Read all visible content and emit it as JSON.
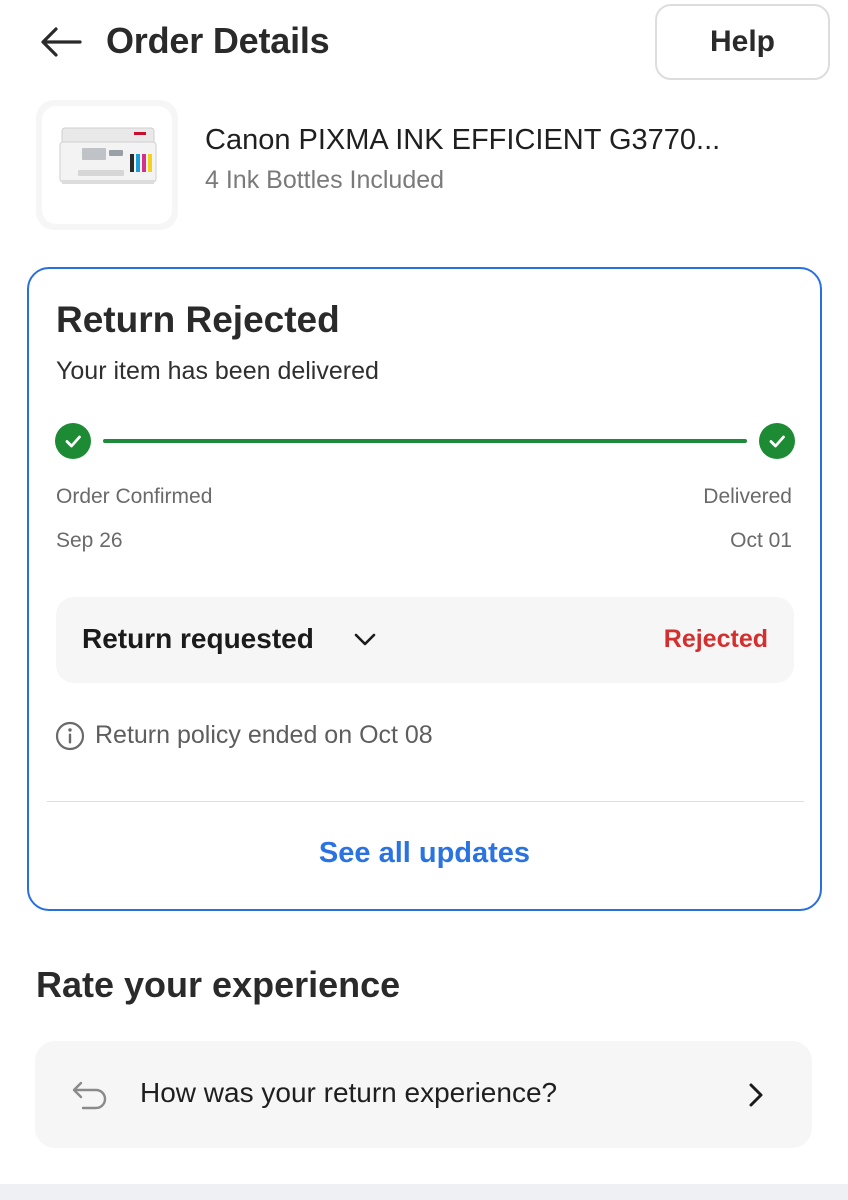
{
  "header": {
    "title": "Order Details",
    "help_label": "Help",
    "back_icon": "arrow-left-icon"
  },
  "product": {
    "name": "Canon PIXMA INK EFFICIENT G3770...",
    "variant": "4 Ink Bottles Included",
    "image": "printer-image"
  },
  "status_card": {
    "title": "Return Rejected",
    "subtitle": "Your item has been delivered",
    "tracker": {
      "progress": 1.0,
      "start": {
        "label": "Order Confirmed",
        "date": "Sep 26"
      },
      "end": {
        "label": "Delivered",
        "date": "Oct 01"
      }
    },
    "return_row": {
      "label": "Return requested",
      "status": "Rejected"
    },
    "policy_text": "Return policy ended on Oct 08",
    "see_all_label": "See all updates"
  },
  "rate": {
    "title": "Rate your experience",
    "question": "How was your return experience?"
  },
  "colors": {
    "accent_blue": "#2a73e0",
    "success_green": "#1c8b34",
    "rejected_red": "#d32f2f"
  }
}
